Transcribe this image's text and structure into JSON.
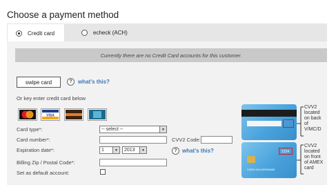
{
  "title": "Choose a payment method",
  "tabs": [
    {
      "label": "Credit card",
      "selected": true
    },
    {
      "label": "echeck (ACH)",
      "selected": false
    }
  ],
  "notice": "Currently there are no Credit Card accounts for this customer.",
  "swipe": {
    "button_label": "swipe card",
    "whats_this": "what's this?"
  },
  "key_enter_text": "Or key enter credit card below",
  "card_logos": [
    {
      "name": "MasterCard",
      "icon": "mastercard-icon"
    },
    {
      "name": "VISA",
      "icon": "visa-icon"
    },
    {
      "name": "Discover",
      "icon": "discover-icon"
    },
    {
      "name": "AMEX",
      "icon": "amex-icon"
    }
  ],
  "form": {
    "card_type_label": "Card type*:",
    "card_type_value": "-- select --",
    "card_number_label": "Card number*:",
    "cvv_label": "CVV2 Code:",
    "expiration_label": "Expiration date*:",
    "exp_month": "1",
    "exp_year": "2013",
    "whats_this": "what's this?",
    "zip_label": "Billing Zip / Postal Code*:",
    "default_label": "Set as default account:"
  },
  "cvv_notes": {
    "back": [
      "CVV2",
      "located",
      "on back",
      "of",
      "V/MC/D"
    ],
    "front": [
      "CVV2",
      "located",
      "on front",
      "of AMEX",
      "card"
    ],
    "front_card_code": "1234",
    "front_card_name": "CARD HOLDERNAME"
  },
  "colors": {
    "tab_bg": "#e6e6e6",
    "panel_bg": "#f2f2f2",
    "notice_bg": "#c9c9c9",
    "link": "#3a78b8",
    "cvv_card_blue": "#4aa3dd"
  }
}
